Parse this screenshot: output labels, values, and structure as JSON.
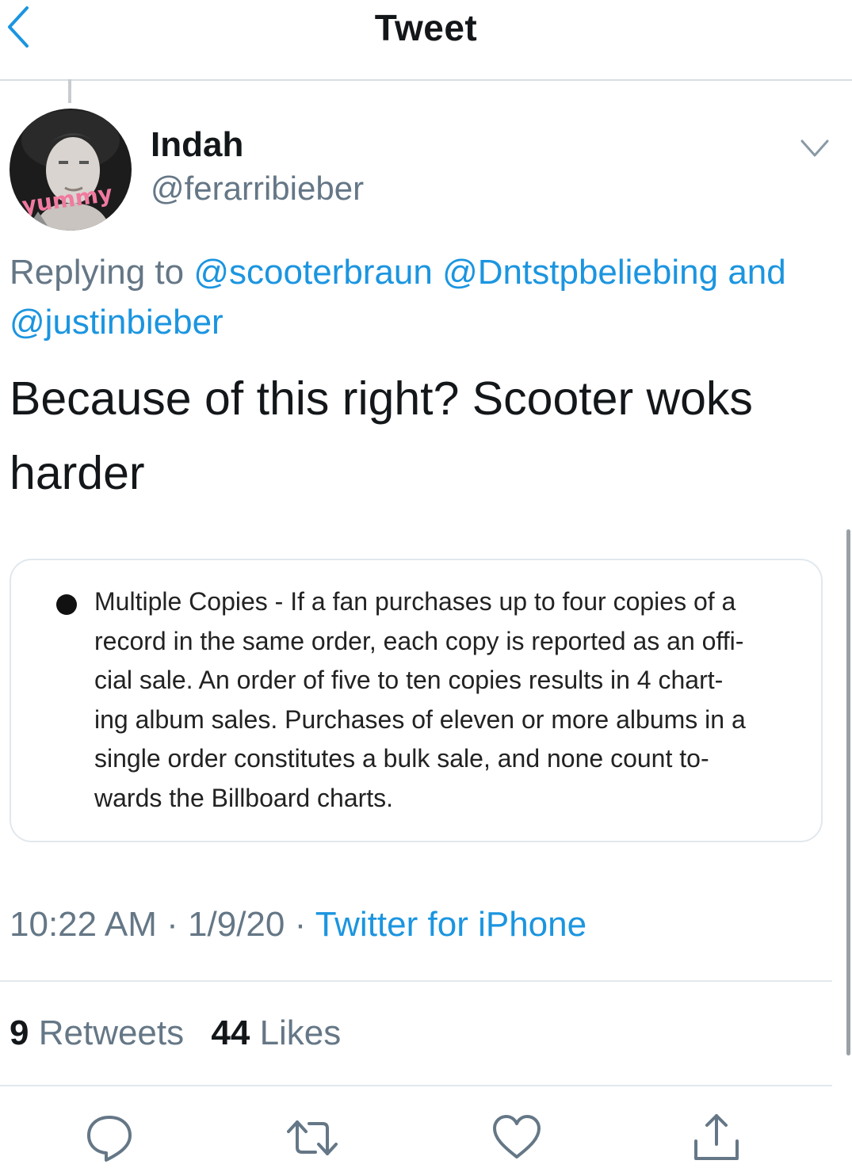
{
  "header": {
    "title": "Tweet",
    "back_icon": "chevron-left-icon"
  },
  "tweet": {
    "author": {
      "name": "Indah",
      "handle": "@ferarribieber",
      "avatar_text": "yummy"
    },
    "reply": {
      "prefix": "Replying to",
      "mentions": [
        "@scooterbraun",
        "@Dntstpbeliebing",
        "@justinbieber"
      ],
      "joiner": "and"
    },
    "text_lines": [
      "Because of this right? Scooter woks",
      "harder"
    ],
    "quote_image": {
      "lines": [
        "Multiple Copies - If a fan purchases up to four copies of a",
        "record in the same order, each copy is reported as an offi-",
        "cial sale. An order of five to ten copies results in 4 chart-",
        "ing album sales. Purchases of eleven or more albums in a",
        "single order constitutes a bulk sale, and none count to-",
        "wards the Billboard charts."
      ]
    },
    "meta": {
      "time": "10:22 AM",
      "date": "1/9/20",
      "separator": "·",
      "source": "Twitter for iPhone"
    },
    "stats": {
      "retweets_count": "9",
      "retweets_label": "Retweets",
      "likes_count": "44",
      "likes_label": "Likes"
    }
  },
  "actions": [
    "reply-icon",
    "retweet-icon",
    "like-icon",
    "share-icon"
  ],
  "colors": {
    "link": "#1b95e0",
    "secondary_text": "#657786",
    "primary_text": "#14171a",
    "divider": "#e1e8ed"
  }
}
